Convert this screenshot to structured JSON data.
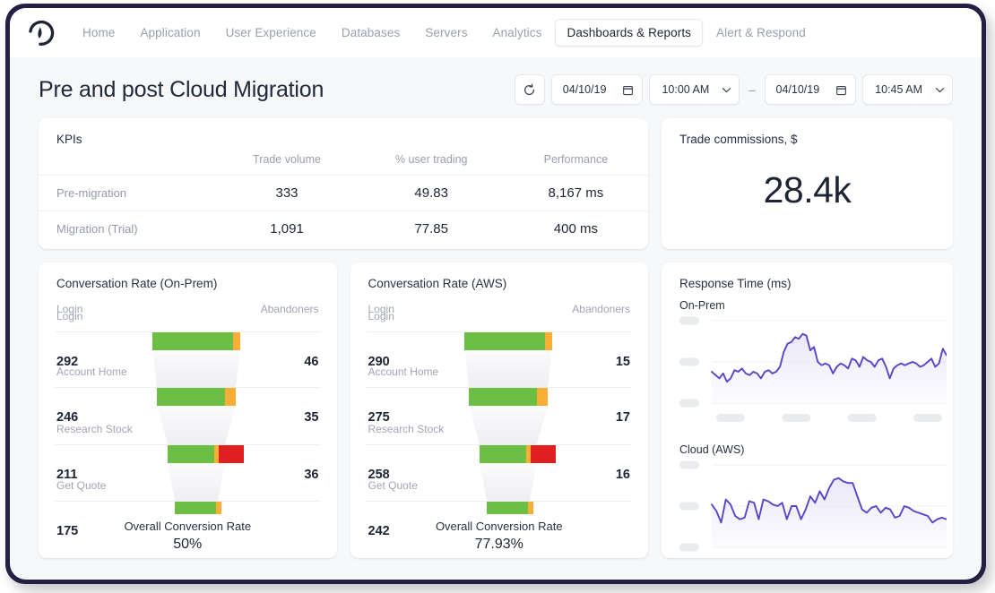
{
  "nav": {
    "logo_icon": "new-relic-logo-icon",
    "tabs": [
      {
        "label": "Home",
        "active": false
      },
      {
        "label": "Application",
        "active": false
      },
      {
        "label": "User Experience",
        "active": false
      },
      {
        "label": "Databases",
        "active": false
      },
      {
        "label": "Servers",
        "active": false
      },
      {
        "label": "Analytics",
        "active": false
      },
      {
        "label": "Dashboards & Reports",
        "active": true
      },
      {
        "label": "Alert & Respond",
        "active": false
      }
    ]
  },
  "header": {
    "title": "Pre and post Cloud Migration",
    "refresh_icon": "refresh-icon",
    "calendar_icon": "calendar-icon",
    "chevron_icon": "chevron-down-icon",
    "range_separator": "–",
    "start_date": "04/10/19",
    "start_time": "10:00 AM",
    "end_date": "04/10/19",
    "end_time": "10:45 AM"
  },
  "kpis": {
    "title": "KPIs",
    "columns": [
      "",
      "Trade volume",
      "% user trading",
      "Performance"
    ],
    "rows": [
      {
        "label": "Pre-migration",
        "trade_volume": "333",
        "pct_user_trading": "49.83",
        "performance": "8,167 ms"
      },
      {
        "label": "Migration (Trial)",
        "trade_volume": "1,091",
        "pct_user_trading": "77.85",
        "performance": "400 ms"
      }
    ]
  },
  "commissions": {
    "title": "Trade commissions, $",
    "value": "28.4k"
  },
  "funnels": [
    {
      "title": "Conversation Rate (On-Prem)",
      "left_header": "Login",
      "right_header": "Abandoners",
      "summary_label": "Overall Conversion Rate",
      "summary_value": "50%",
      "steps": [
        {
          "label": "Login",
          "value": "292",
          "abandoners": "46"
        },
        {
          "label": "Account Home",
          "value": "246",
          "abandoners": "35"
        },
        {
          "label": "Research Stock",
          "value": "211",
          "abandoners": "36"
        },
        {
          "label": "Get Quote",
          "value": "175",
          "abandoners": ""
        }
      ]
    },
    {
      "title": "Conversation Rate (AWS)",
      "left_header": "Login",
      "right_header": "Abandoners",
      "summary_label": "Overall Conversion Rate",
      "summary_value": "77.93%",
      "steps": [
        {
          "label": "Login",
          "value": "290",
          "abandoners": "15"
        },
        {
          "label": "Account Home",
          "value": "275",
          "abandoners": "17"
        },
        {
          "label": "Research Stock",
          "value": "258",
          "abandoners": "16"
        },
        {
          "label": "Get Quote",
          "value": "242",
          "abandoners": ""
        }
      ]
    }
  ],
  "response_time": {
    "title": "Response Time (ms)",
    "charts": [
      {
        "label": "On-Prem"
      },
      {
        "label": "Cloud (AWS)"
      }
    ]
  },
  "colors": {
    "frame": "#231f45",
    "page_bg": "#f7f8fa",
    "card_bg": "#ffffff",
    "text_dark": "#1d2433",
    "text_muted": "#9a9ead",
    "funnel_green": "#6cbe45",
    "funnel_orange": "#fbae35",
    "funnel_red": "#e02020",
    "funnel_body": "#f4f5f7",
    "spark_line": "#5a45c8",
    "spark_fill": "#e9e7f8",
    "pill_gray": "#e9ebef"
  },
  "chart_data": [
    {
      "type": "bar",
      "name": "funnel-on-prem",
      "title": "Conversation Rate (On-Prem)",
      "categories": [
        "Login",
        "Account Home",
        "Research Stock",
        "Get Quote"
      ],
      "values": [
        292,
        246,
        211,
        175
      ],
      "abandoners": [
        46,
        35,
        36,
        null
      ],
      "segments": [
        {
          "green": 292,
          "orange": 8,
          "red": 0
        },
        {
          "green": 246,
          "orange": 12,
          "red": 0
        },
        {
          "green": 211,
          "orange": 6,
          "red": 36
        },
        {
          "green": 175,
          "orange": 7,
          "red": 0
        }
      ],
      "overall_conversion_rate": 50,
      "xlabel": "",
      "ylabel": "",
      "grid": true,
      "legend": "none"
    },
    {
      "type": "bar",
      "name": "funnel-aws",
      "title": "Conversation Rate (AWS)",
      "categories": [
        "Login",
        "Account Home",
        "Research Stock",
        "Get Quote"
      ],
      "values": [
        290,
        275,
        258,
        242
      ],
      "abandoners": [
        15,
        17,
        16,
        null
      ],
      "segments": [
        {
          "green": 290,
          "orange": 8,
          "red": 0
        },
        {
          "green": 275,
          "orange": 13,
          "red": 0
        },
        {
          "green": 258,
          "orange": 6,
          "red": 16
        },
        {
          "green": 242,
          "orange": 7,
          "red": 0
        }
      ],
      "overall_conversion_rate": 77.93,
      "xlabel": "",
      "ylabel": "",
      "grid": true,
      "legend": "none"
    },
    {
      "type": "area",
      "name": "response-time-on-prem",
      "title": "On-Prem",
      "ylabel": "ms",
      "grid": true,
      "legend": "none",
      "ylim": [
        0,
        100
      ],
      "values": [
        38,
        34,
        30,
        36,
        26,
        30,
        40,
        38,
        42,
        36,
        34,
        38,
        36,
        30,
        38,
        40,
        36,
        38,
        44,
        62,
        72,
        74,
        80,
        78,
        84,
        82,
        64,
        68,
        50,
        46,
        48,
        46,
        36,
        44,
        48,
        46,
        42,
        54,
        52,
        44,
        56,
        52,
        50,
        44,
        52,
        54,
        44,
        30,
        42,
        46,
        48,
        46,
        48,
        50,
        48,
        44,
        46,
        50,
        54,
        44,
        48,
        66,
        58
      ]
    },
    {
      "type": "area",
      "name": "response-time-cloud-aws",
      "title": "Cloud (AWS)",
      "ylabel": "ms",
      "grid": true,
      "legend": "none",
      "ylim": [
        0,
        100
      ],
      "values": [
        52,
        44,
        30,
        58,
        52,
        38,
        34,
        36,
        56,
        54,
        34,
        58,
        56,
        52,
        50,
        54,
        34,
        50,
        50,
        34,
        46,
        62,
        54,
        68,
        58,
        72,
        82,
        84,
        80,
        78,
        78,
        62,
        46,
        42,
        48,
        50,
        42,
        48,
        46,
        36,
        38,
        50,
        48,
        44,
        42,
        40,
        38,
        30,
        34,
        36,
        34
      ]
    }
  ]
}
